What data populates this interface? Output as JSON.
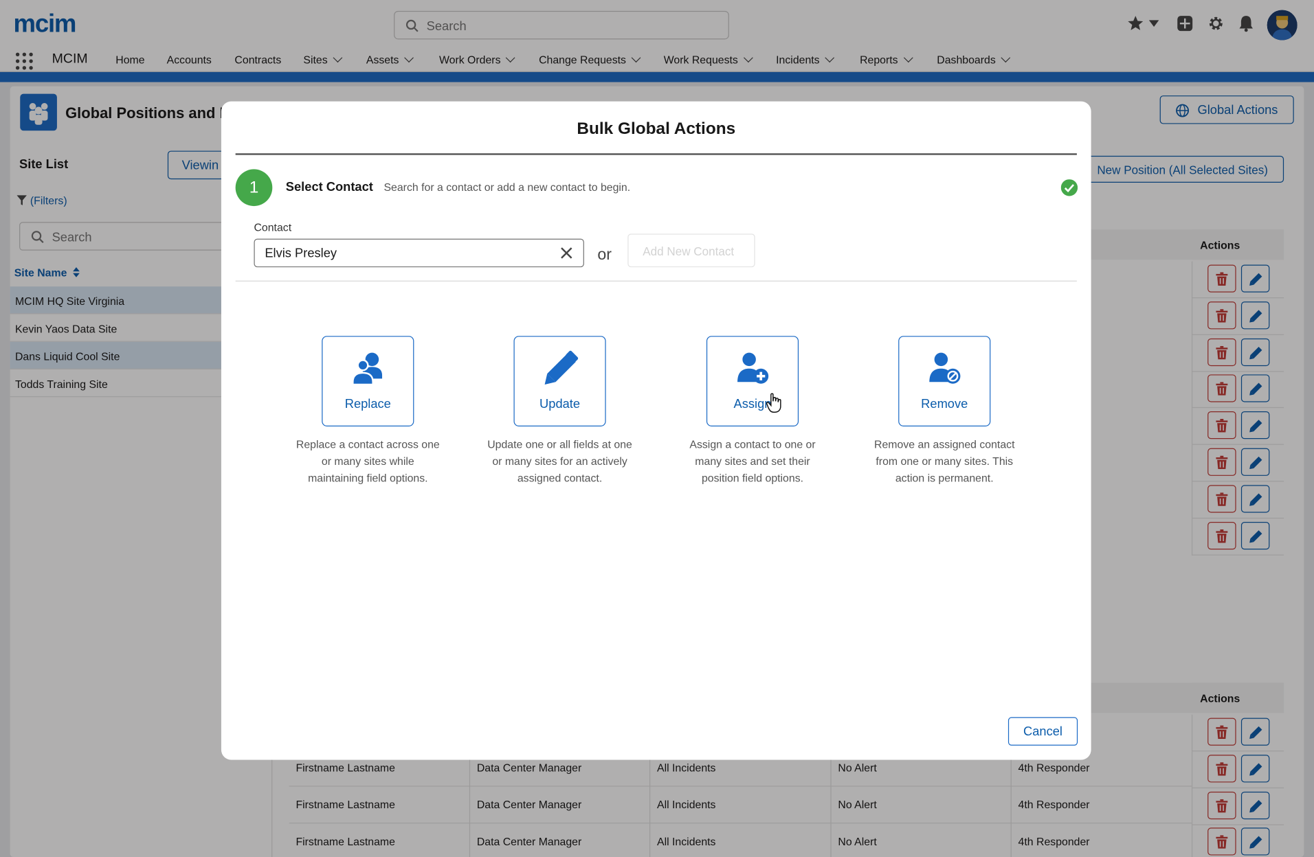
{
  "header": {
    "logo": "mcim",
    "search_placeholder": "Search",
    "app_name": "MCIM",
    "nav": [
      "Home",
      "Accounts",
      "Contracts",
      "Sites",
      "Assets",
      "Work Orders",
      "Change Requests",
      "Work Requests",
      "Incidents",
      "Reports",
      "Dashboards"
    ]
  },
  "page": {
    "title": "Global Positions and Re",
    "global_actions": "Global Actions",
    "new_position": "New Position (All Selected Sites)",
    "actions_header": "Actions"
  },
  "site_list": {
    "title": "Site List",
    "viewing": "Viewin",
    "filters": "(Filters)",
    "search_placeholder": "Search",
    "column": "Site Name",
    "sites": [
      {
        "name": "MCIM HQ Site Virginia",
        "selected": true
      },
      {
        "name": "Kevin Yaos Data Site",
        "selected": false
      },
      {
        "name": "Dans Liquid Cool Site",
        "selected": true
      },
      {
        "name": "Todds Training Site",
        "selected": false
      }
    ]
  },
  "table_rows": [
    {
      "name": "Firstname Lastname",
      "role": "Data Center Manager",
      "incidents": "All Incidents",
      "alert": "No Alert",
      "responder": "4th Responder"
    },
    {
      "name": "Firstname Lastname",
      "role": "Data Center Manager",
      "incidents": "All Incidents",
      "alert": "No Alert",
      "responder": "4th Responder"
    },
    {
      "name": "Firstname Lastname",
      "role": "Data Center Manager",
      "incidents": "All Incidents",
      "alert": "No Alert",
      "responder": "4th Responder"
    }
  ],
  "modal": {
    "title": "Bulk Global Actions",
    "step_number": "1",
    "step_title": "Select Contact",
    "step_desc": "Search for a contact or add a new contact to begin.",
    "contact_label": "Contact",
    "contact_value": "Elvis Presley",
    "or": "or",
    "add_new": "Add New Contact",
    "cards": [
      {
        "label": "Replace",
        "icon": "replace-users-icon",
        "desc": "Replace a contact across one or many sites while maintaining field options."
      },
      {
        "label": "Update",
        "icon": "pencil-icon",
        "desc": "Update one or all fields at one or many sites for an actively assigned contact."
      },
      {
        "label": "Assign",
        "icon": "user-add-icon",
        "desc": "Assign a contact to one or many sites and set their position field options."
      },
      {
        "label": "Remove",
        "icon": "user-remove-icon",
        "desc": "Remove an assigned contact from one or many sites. This action is permanent."
      }
    ],
    "cancel": "Cancel"
  },
  "colors": {
    "brand": "#1b6ac6",
    "success": "#45a84a",
    "danger": "#c23934"
  }
}
